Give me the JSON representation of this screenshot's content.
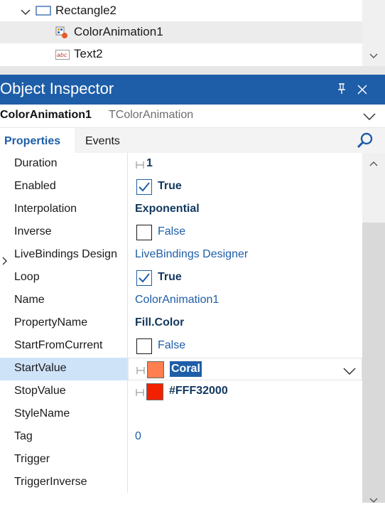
{
  "structure": {
    "items": [
      {
        "label": "Rectangle2",
        "icon": "rectangle-icon",
        "expanded": true,
        "selected": false
      },
      {
        "label": "ColorAnimation1",
        "icon": "color-animation-icon",
        "selected": true
      },
      {
        "label": "Text2",
        "icon": "text-abc-icon",
        "selected": false
      }
    ]
  },
  "inspector": {
    "title": "Object Inspector",
    "component": {
      "name": "ColorAnimation1",
      "type": "TColorAnimation"
    },
    "tabs": [
      {
        "label": "Properties",
        "active": true
      },
      {
        "label": "Events",
        "active": false
      }
    ],
    "properties": [
      {
        "name": "Duration",
        "kind": "number",
        "value": "1"
      },
      {
        "name": "Enabled",
        "kind": "bool",
        "checked": true,
        "value": "True"
      },
      {
        "name": "Interpolation",
        "kind": "enum",
        "value": "Exponential"
      },
      {
        "name": "Inverse",
        "kind": "bool",
        "checked": false,
        "value": "False"
      },
      {
        "name": "LiveBindings Design",
        "kind": "link",
        "value": "LiveBindings Designer",
        "expandable": true
      },
      {
        "name": "Loop",
        "kind": "bool",
        "checked": true,
        "value": "True"
      },
      {
        "name": "Name",
        "kind": "text",
        "value": "ColorAnimation1"
      },
      {
        "name": "PropertyName",
        "kind": "enum",
        "value": "Fill.Color"
      },
      {
        "name": "StartFromCurrent",
        "kind": "bool",
        "checked": false,
        "value": "False"
      },
      {
        "name": "StartValue",
        "kind": "color",
        "value": "Coral",
        "color": "#FF7F50",
        "selected": true
      },
      {
        "name": "StopValue",
        "kind": "color",
        "value": "#FFF32000",
        "color": "#F32000"
      },
      {
        "name": "StyleName",
        "kind": "text",
        "value": ""
      },
      {
        "name": "Tag",
        "kind": "text",
        "value": "0"
      },
      {
        "name": "Trigger",
        "kind": "text",
        "value": ""
      },
      {
        "name": "TriggerInverse",
        "kind": "text",
        "value": ""
      }
    ]
  },
  "colors": {
    "accent": "#1e5ea8",
    "selected_row": "#cfe3f8",
    "value_text": "#12375e"
  }
}
